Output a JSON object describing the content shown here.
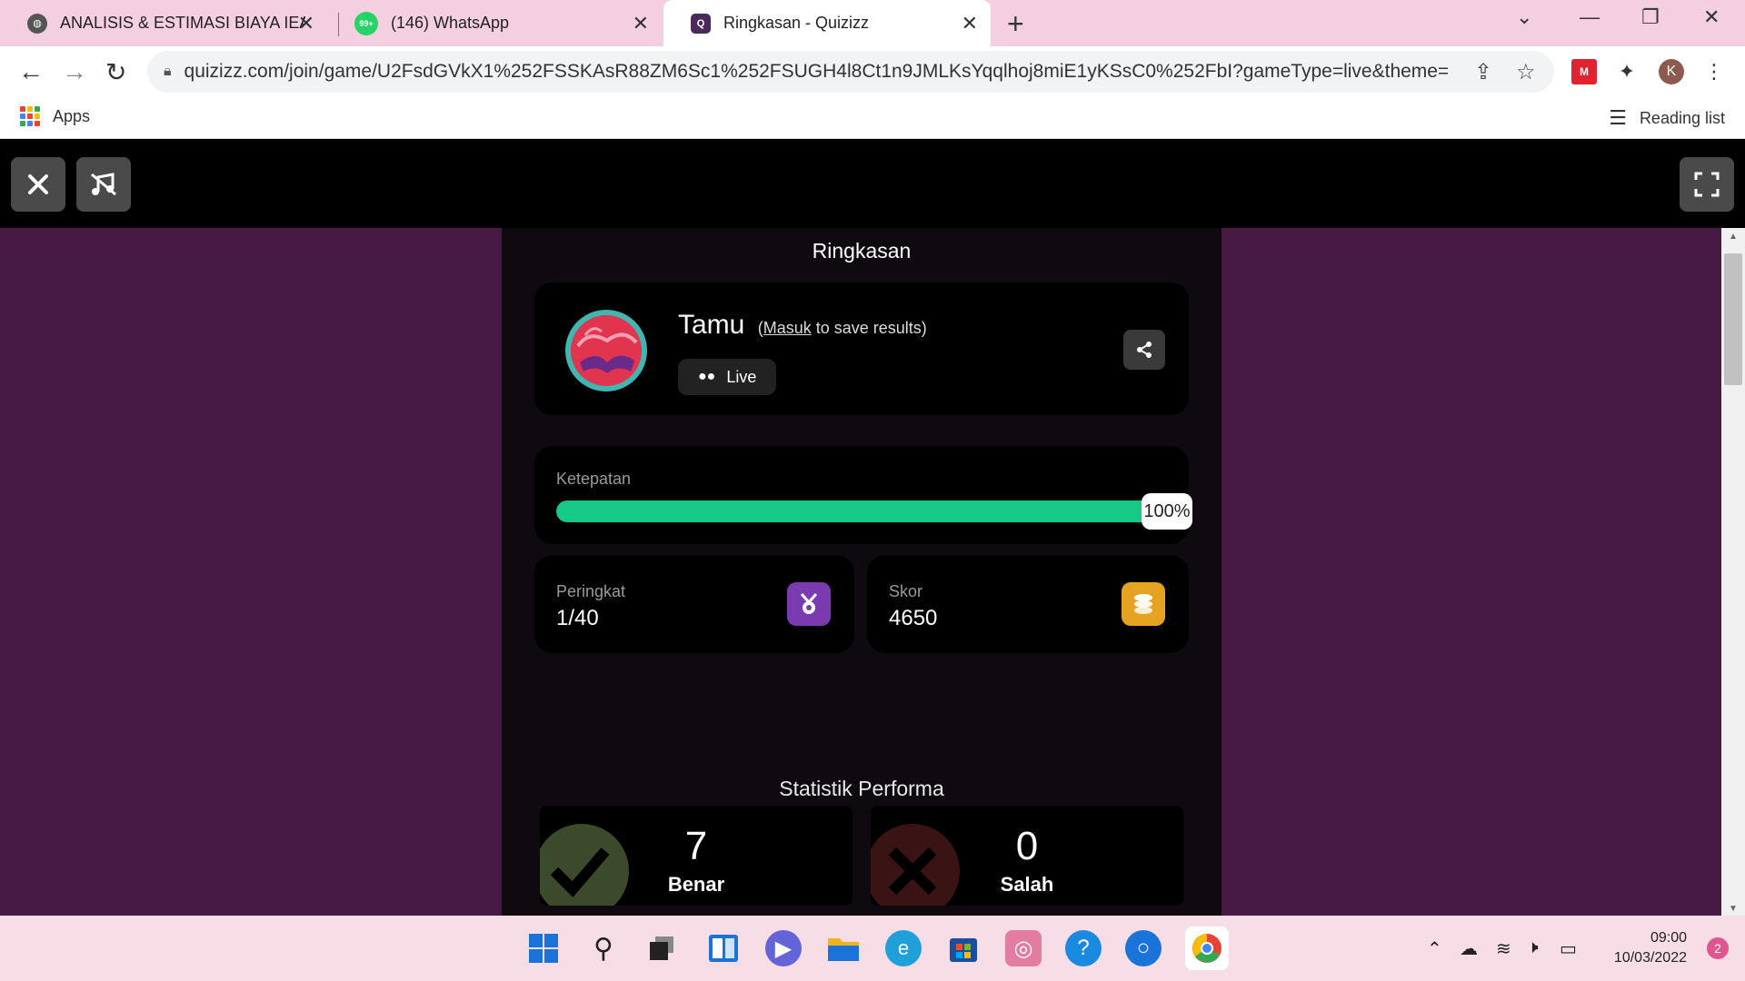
{
  "browser": {
    "tabs": [
      {
        "title": "ANALISIS & ESTIMASI BIAYA IEA",
        "icon": "globe-icon"
      },
      {
        "title": "(146) WhatsApp",
        "icon": "whatsapp-icon",
        "badge": "99+"
      },
      {
        "title": "Ringkasan - Quizizz",
        "icon": "quizizz-icon"
      }
    ],
    "url": "quizizz.com/join/game/U2FsdGVkX1%252FSSKAsR88ZM6Sc1%252FSUGH4l8Ct1n9JMLKsYqqlhoj8miE1yKSsC0%252FbI?gameType=live&theme=class...",
    "profile_initial": "K",
    "bookmarks": {
      "apps_label": "Apps",
      "reading_list_label": "Reading list"
    }
  },
  "quiz": {
    "heading": "Ringkasan",
    "player": {
      "name": "Tamu",
      "login_link": "Masuk",
      "login_suffix": "to save results)",
      "login_prefix": "(",
      "mode": "Live"
    },
    "accuracy": {
      "label": "Ketepatan",
      "percent_text": "100%",
      "fraction": 1.0
    },
    "rank": {
      "label": "Peringkat",
      "value": "1/40"
    },
    "score": {
      "label": "Skor",
      "value": "4650"
    },
    "performance_title": "Statistik Performa",
    "correct": {
      "count": "7",
      "label": "Benar"
    },
    "wrong": {
      "count": "0",
      "label": "Salah"
    }
  },
  "taskbar": {
    "time": "09:00",
    "date": "10/03/2022",
    "notifications": "2"
  },
  "colors": {
    "page_bg": "#461a42",
    "accent_green": "#16c986",
    "rank_badge": "#7a3bb0",
    "score_badge": "#e6a321"
  }
}
